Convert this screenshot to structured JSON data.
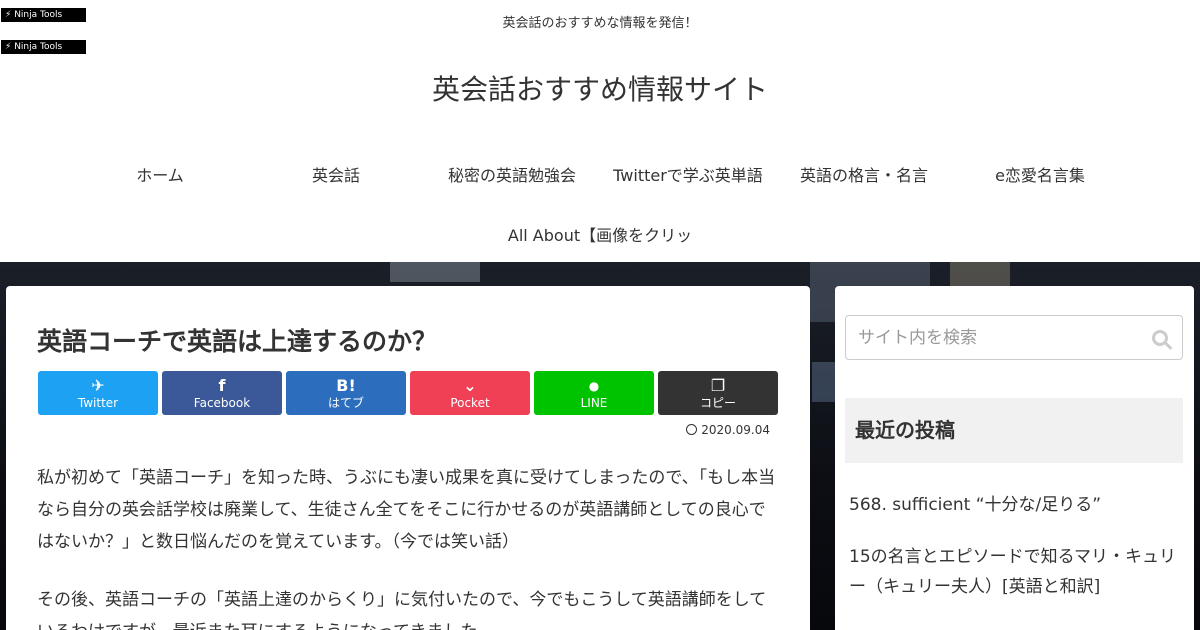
{
  "ninja": {
    "label1": "Ninja Tools",
    "label2": "Ninja Tools"
  },
  "header": {
    "tagline": "英会話のおすすめな情報を発信！",
    "title": "英会話おすすめ情報サイト"
  },
  "nav": {
    "items": [
      "ホーム",
      "英会話",
      "秘密の英語勉強会",
      "Twitterで学ぶ英単語",
      "英語の格言・名言",
      "e恋愛名言集",
      "All About【画像をクリッ"
    ]
  },
  "post": {
    "title": "英語コーチで英語は上達するのか？",
    "date": "2020.09.04",
    "paragraphs": [
      "私が初めて「英語コーチ」を知った時、うぶにも凄い成果を真に受けてしまったので、「もし本当なら自分の英会話学校は廃業して、生徒さん全てをそこに行かせるのが英語講師としての良心ではないか？」と数日悩んだのを覚えています。（今では笑い話）",
      "その後、英語コーチの「英語上達のからくり」に気付いたので、今でもこうして英語講師をしているわけですが、最近また耳にするようになってきました。"
    ]
  },
  "share": {
    "buttons": [
      {
        "label": "Twitter",
        "icon": "twitter-bird-icon",
        "color": "#1da1f2"
      },
      {
        "label": "Facebook",
        "icon": "facebook-f-icon",
        "color": "#3b5998"
      },
      {
        "label": "はてブ",
        "icon": "hatena-b-icon",
        "color": "#2c6ebd"
      },
      {
        "label": "Pocket",
        "icon": "pocket-icon",
        "color": "#ef4056"
      },
      {
        "label": "LINE",
        "icon": "line-icon",
        "color": "#00c300"
      },
      {
        "label": "コピー",
        "icon": "copy-icon",
        "color": "#333333"
      }
    ]
  },
  "sidebar": {
    "search_placeholder": "サイト内を検索",
    "widget_title": "最近の投稿",
    "recent": [
      "568. sufficient “十分な/足りる”",
      "15の名言とエピソードで知るマリ・キュリー（キュリー夫人）[英語と和訳]"
    ]
  }
}
